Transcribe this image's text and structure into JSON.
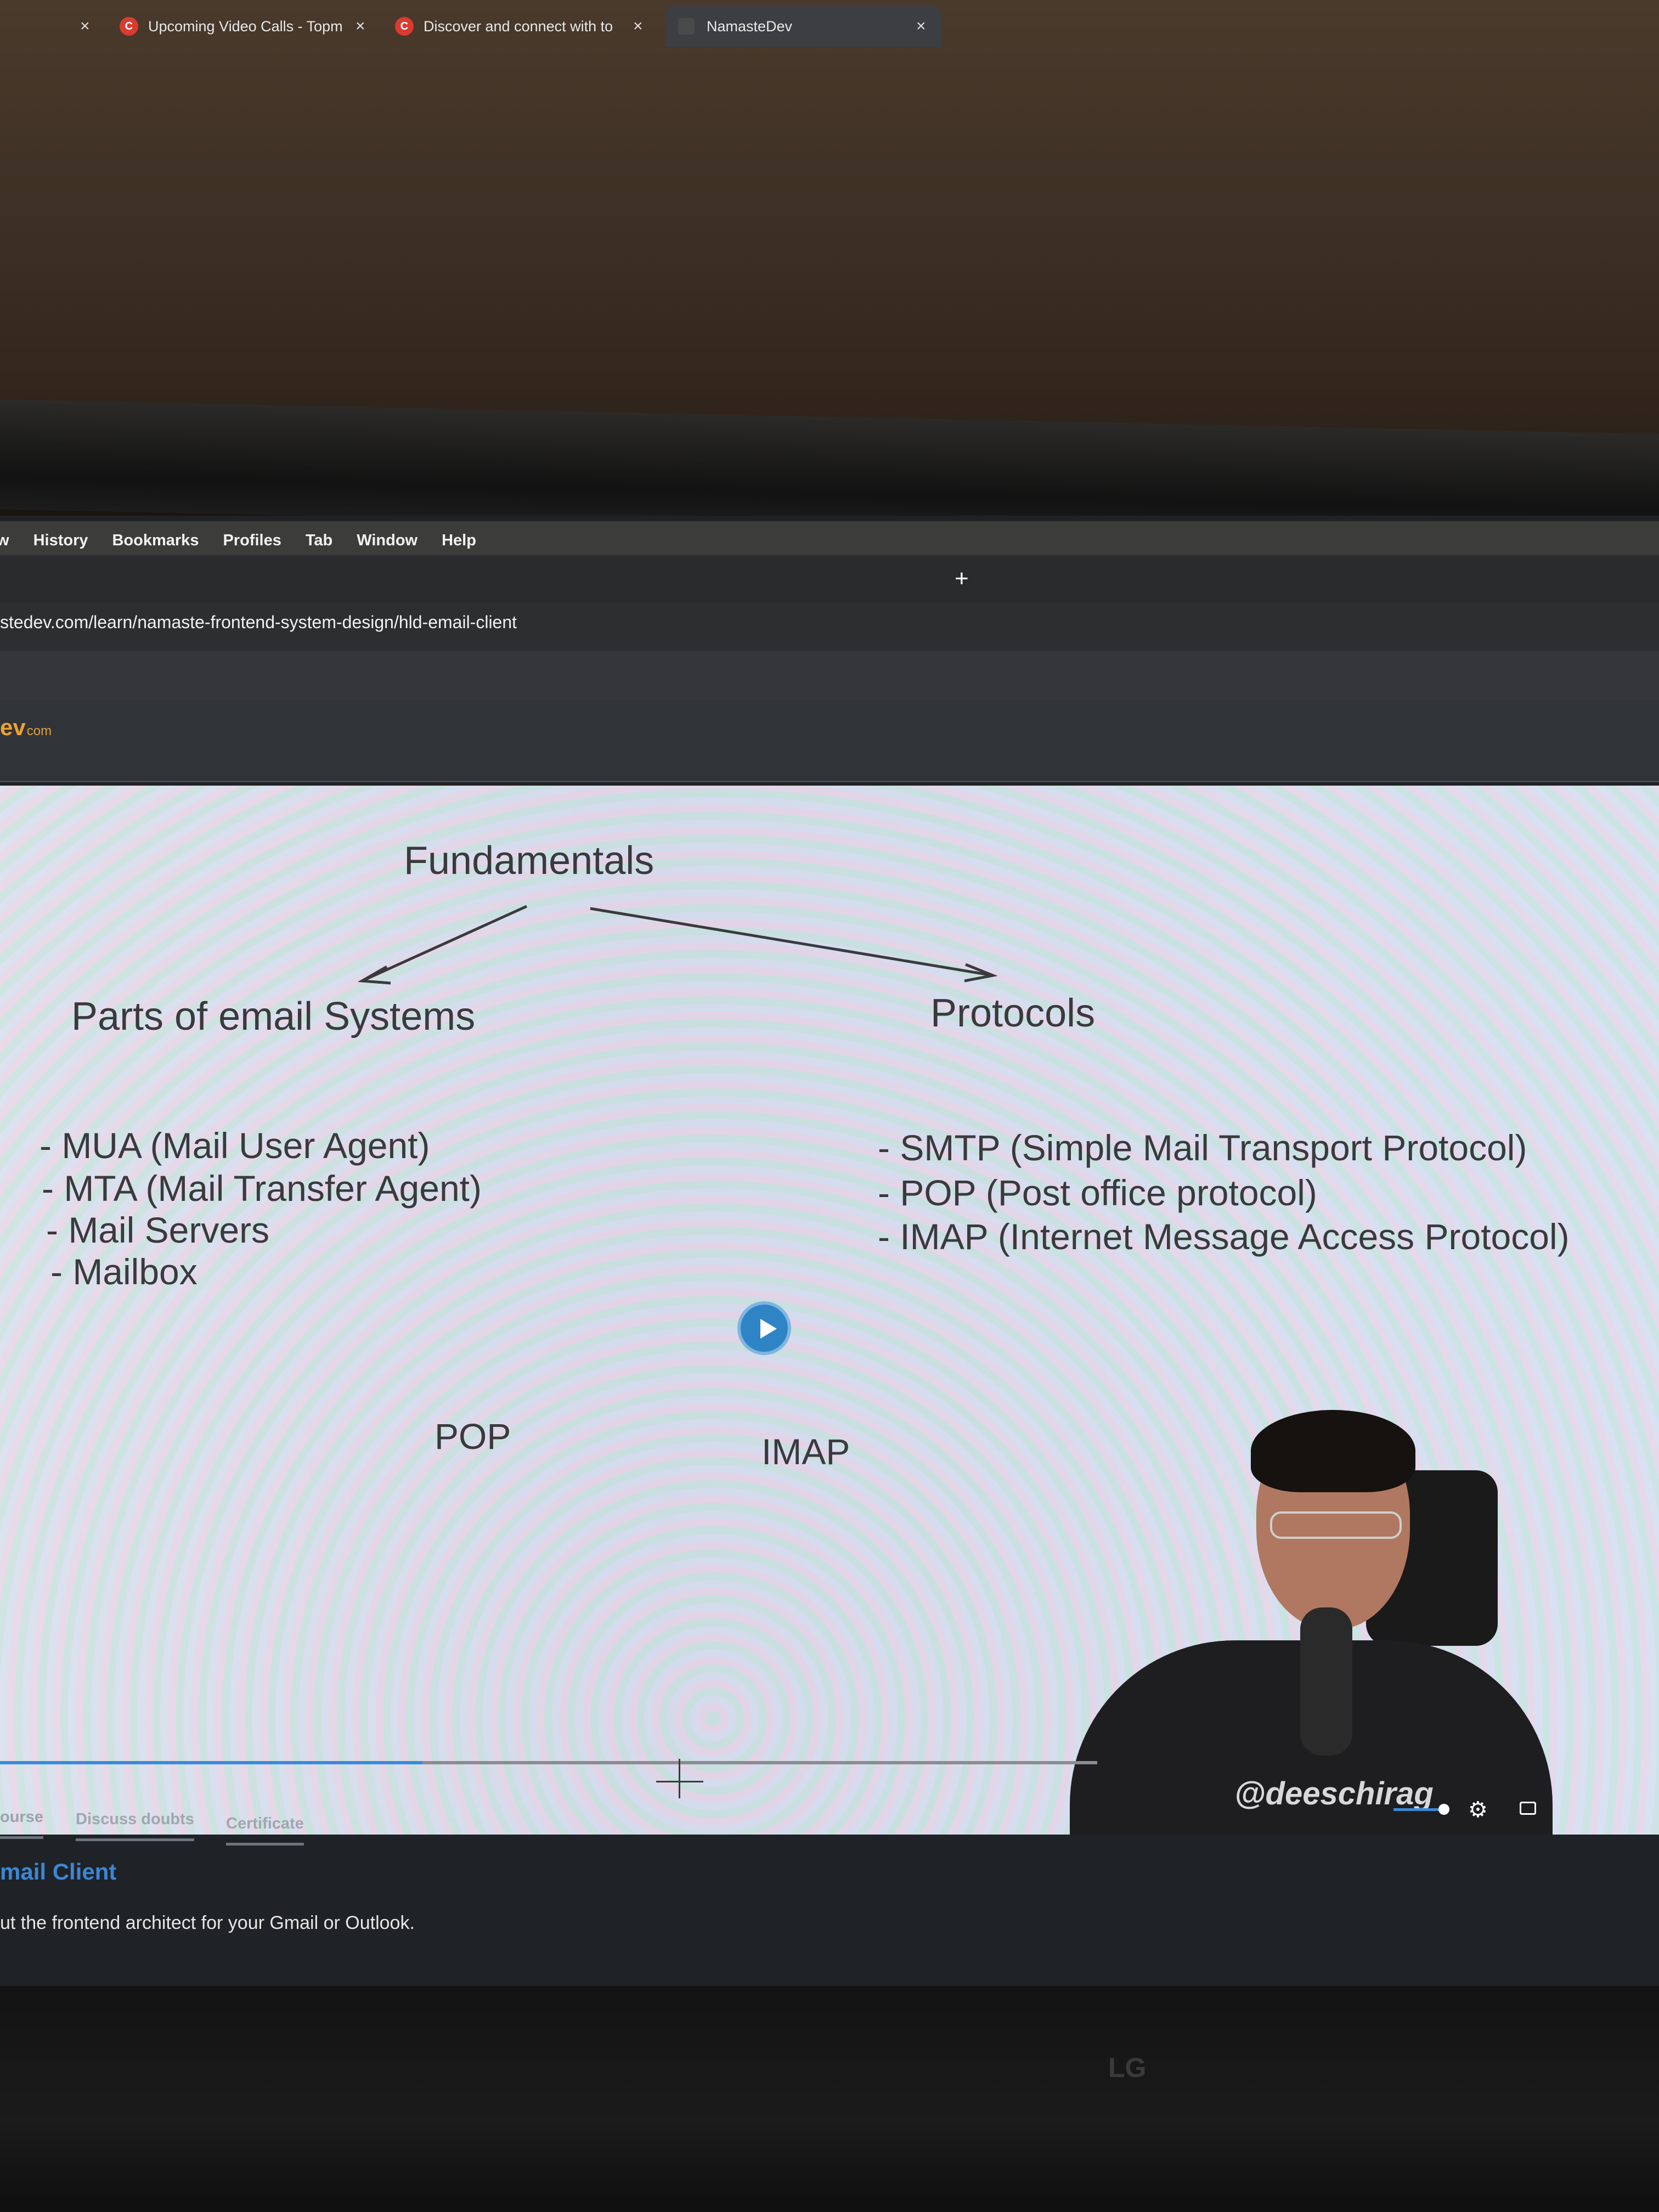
{
  "menubar": {
    "items": [
      "w",
      "History",
      "Bookmarks",
      "Profiles",
      "Tab",
      "Window",
      "Help"
    ]
  },
  "tabs": [
    {
      "label": ""
    },
    {
      "label": "Upcoming Video Calls - Topm"
    },
    {
      "label": "Discover and connect with to"
    },
    {
      "label": "NamasteDev"
    }
  ],
  "address": {
    "url": "stedev.com/learn/namaste-frontend-system-design/hld-email-client"
  },
  "site": {
    "logo": "ev",
    "logo_suffix": "com"
  },
  "slide": {
    "title": "Fundamentals",
    "left_heading": "Parts of email Systems",
    "right_heading": "Protocols",
    "left_items": [
      "- MUA (Mail User Agent)",
      "- MTA (Mail Transfer Agent)",
      "- Mail Servers",
      "- Mailbox"
    ],
    "right_items": [
      "- SMTP (Simple Mail Transport Protocol)",
      "- POP (Post office protocol)",
      "- IMAP (Internet Message Access Protocol)"
    ],
    "label_pop": "POP",
    "label_imap": "IMAP"
  },
  "video": {
    "watermark": "@deeschirag",
    "progress": 0.385,
    "volume": 0.9
  },
  "page_tabs": [
    "ourse",
    "Discuss doubts",
    "Certificate"
  ],
  "lesson": {
    "title": "mail Client",
    "description": "ut the frontend architect for your Gmail or Outlook."
  },
  "monitor": {
    "brand": "LG"
  },
  "colors": {
    "accent": "#3a8bd8",
    "logo": "#f0a030",
    "tab_favicon": "#d93b30"
  }
}
